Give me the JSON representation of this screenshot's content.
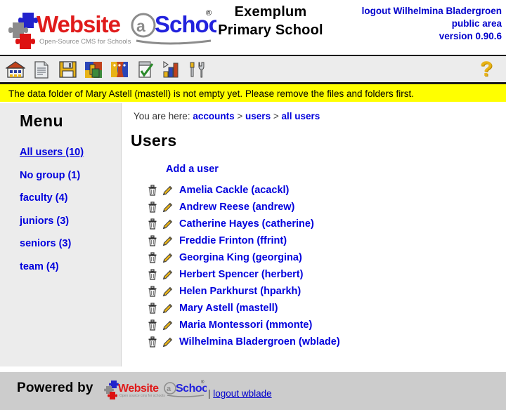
{
  "header": {
    "logo_alt": "Website@School",
    "logo_tagline": "Open-Source CMS for Schools",
    "school_name_line1": "Exemplum",
    "school_name_line2": "Primary School",
    "logout_label": "logout Wilhelmina Bladergroen",
    "area_label": "public area",
    "version_label": "version 0.90.6",
    "link_color": "#0000cc"
  },
  "toolbar": {
    "items": [
      {
        "icon": "school-house-icon",
        "label": "Website"
      },
      {
        "icon": "page-document-icon",
        "label": "Pages"
      },
      {
        "icon": "floppy-disk-icon",
        "label": "File manager"
      },
      {
        "icon": "modules-puzzle-icon",
        "label": "Modules"
      },
      {
        "icon": "accounts-people-icon",
        "label": "Accounts"
      },
      {
        "icon": "checklist-icon",
        "label": "Tasks"
      },
      {
        "icon": "bar-chart-icon",
        "label": "Statistics"
      },
      {
        "icon": "tools-wrench-icon",
        "label": "Tools"
      }
    ],
    "help_icon": "question-mark-icon",
    "help_label": "?"
  },
  "message": {
    "text": "The data folder of Mary Astell (mastell) is not empty yet. Please remove the files and folders first.",
    "background": "#ffff00"
  },
  "sidebar": {
    "title": "Menu",
    "items": [
      {
        "label": "All users (10)",
        "current": true
      },
      {
        "label": "No group (1)",
        "current": false
      },
      {
        "label": "faculty (4)",
        "current": false
      },
      {
        "label": "juniors (3)",
        "current": false
      },
      {
        "label": "seniors (3)",
        "current": false
      },
      {
        "label": "team (4)",
        "current": false
      }
    ]
  },
  "main": {
    "breadcrumb_prefix": "You are here:",
    "breadcrumb": [
      {
        "label": "accounts"
      },
      {
        "label": "users"
      },
      {
        "label": "all users"
      }
    ],
    "breadcrumb_separator": ">",
    "page_title": "Users",
    "add_user_label": "Add a user",
    "row_icons": {
      "delete": "trash-can-icon",
      "edit": "pencil-edit-icon"
    },
    "users": [
      {
        "label": "Amelia Cackle (acackl)"
      },
      {
        "label": "Andrew Reese (andrew)"
      },
      {
        "label": "Catherine Hayes (catherine)"
      },
      {
        "label": "Freddie Frinton (ffrint)"
      },
      {
        "label": "Georgina King (georgina)"
      },
      {
        "label": "Herbert Spencer (herbert)"
      },
      {
        "label": "Helen Parkhurst (hparkh)"
      },
      {
        "label": "Mary Astell (mastell)"
      },
      {
        "label": "Maria Montessori (mmonte)"
      },
      {
        "label": "Wilhelmina Bladergroen (wblade)"
      }
    ]
  },
  "footer": {
    "powered_by": "Powered by",
    "logo_alt": "Website@School",
    "logo_tagline": "Open source cms for schools",
    "separator": "|",
    "logout_label": "logout wblade"
  }
}
